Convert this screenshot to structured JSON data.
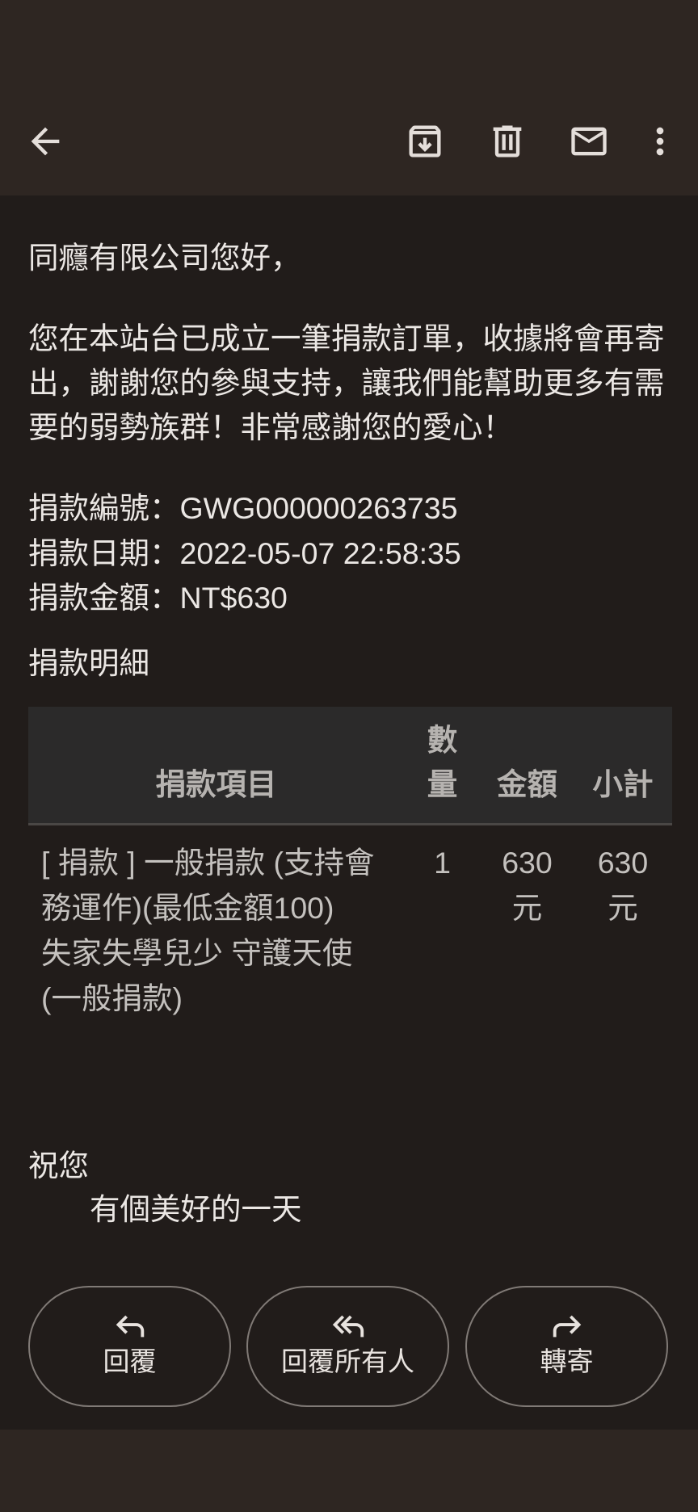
{
  "toolbar": {
    "back_icon": "arrow-back-icon",
    "archive_icon": "archive-icon",
    "delete_icon": "trash-icon",
    "mail_icon": "mail-icon",
    "more_icon": "more-vert-icon"
  },
  "email": {
    "greeting": "同癮有限公司您好，",
    "message": "您在本站台已成立一筆捐款訂單，收據將會再寄出，謝謝您的參與支持，讓我們能幫助更多有需要的弱勢族群！非常感謝您的愛心！",
    "details": [
      {
        "label": "捐款編號：",
        "value": "GWG000000263735"
      },
      {
        "label": "捐款日期：",
        "value": "2022-05-07 22:58:35"
      },
      {
        "label": "捐款金額：",
        "value": "NT$630"
      }
    ],
    "details_heading": "捐款明細",
    "table": {
      "headers": {
        "item": "捐款項目",
        "quantity": "數量",
        "amount": "金額",
        "subtotal": "小計"
      },
      "rows": [
        {
          "item_lines": [
            "[ 捐款 ] 一般捐款 (支持會務運作)(最低金額100)",
            "失家失學兒少 守護天使 (一般捐款)"
          ],
          "quantity": "1",
          "amount": "630",
          "amount_unit": "元",
          "subtotal": "630",
          "subtotal_unit": "元"
        }
      ]
    },
    "closing": "祝您",
    "closing_wish": "有個美好的一天"
  },
  "actions": [
    {
      "label": "回覆",
      "icon": "reply-icon"
    },
    {
      "label": "回覆所有人",
      "icon": "reply-all-icon"
    },
    {
      "label": "轉寄",
      "icon": "forward-icon"
    }
  ],
  "colors": {
    "app_bar": "#2e2622",
    "background": "#211c1a",
    "text": "#ebe7e4",
    "table_header_bg": "#2b2a2a",
    "table_text": "#c4c1be",
    "button_border": "#807a76"
  }
}
